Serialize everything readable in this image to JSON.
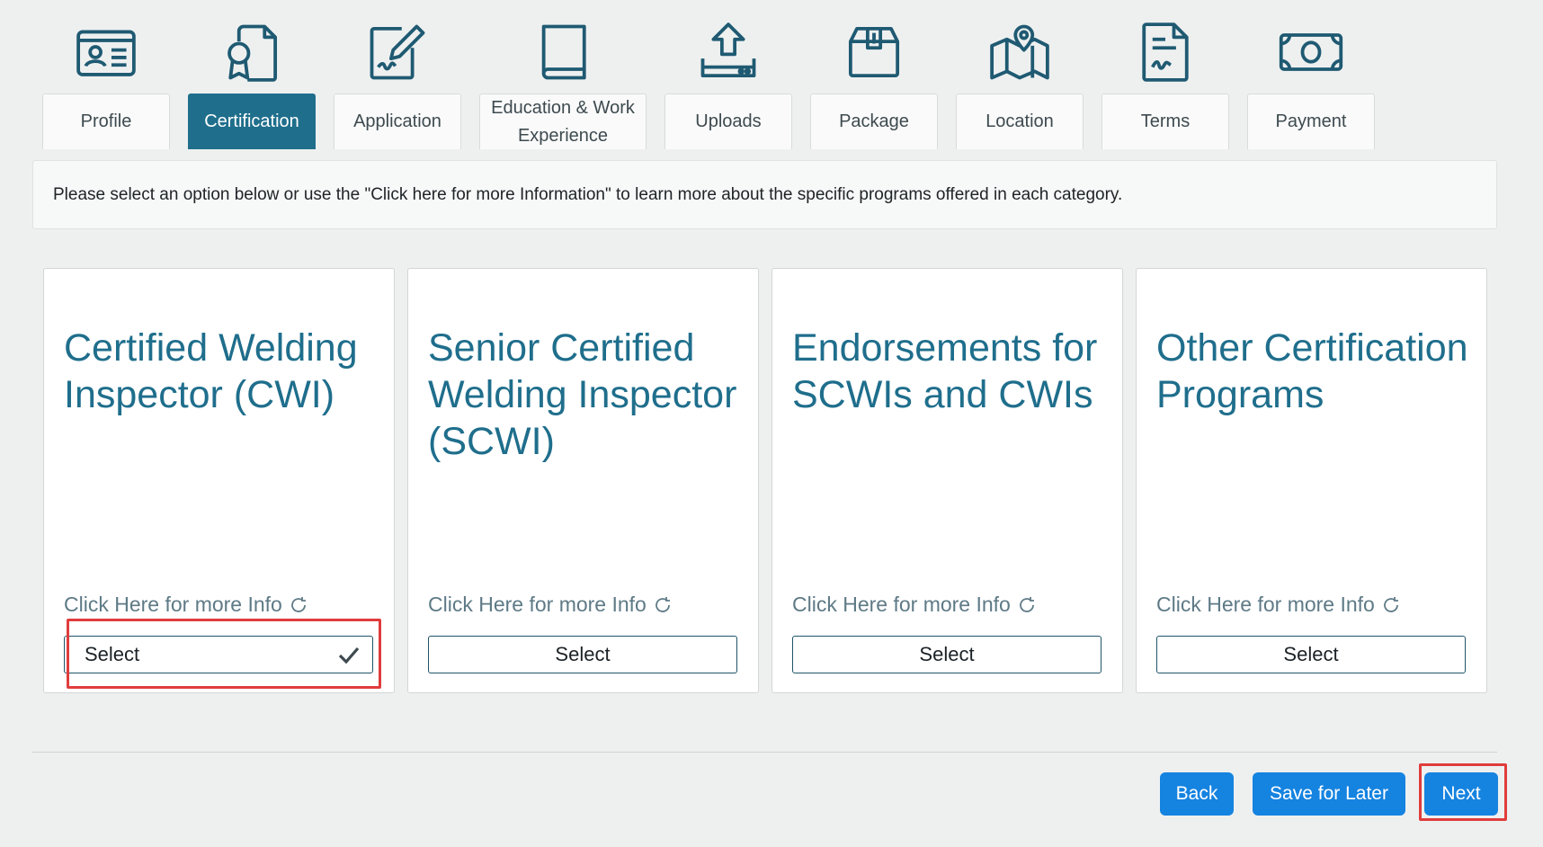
{
  "colors": {
    "accent": "#1f6e8c",
    "primary_button": "#1583e0",
    "highlight": "#e03c3c",
    "page_bg": "#eef0f0"
  },
  "steps": [
    {
      "label": "Profile",
      "icon": "id-card-icon",
      "active": false
    },
    {
      "label": "Certification",
      "icon": "certificate-icon",
      "active": true
    },
    {
      "label": "Application",
      "icon": "signature-pen-icon",
      "active": false
    },
    {
      "label": "Education & Work Experience",
      "icon": "book-icon",
      "active": false
    },
    {
      "label": "Uploads",
      "icon": "upload-icon",
      "active": false
    },
    {
      "label": "Package",
      "icon": "package-icon",
      "active": false
    },
    {
      "label": "Location",
      "icon": "map-pin-icon",
      "active": false
    },
    {
      "label": "Terms",
      "icon": "document-signature-icon",
      "active": false
    },
    {
      "label": "Payment",
      "icon": "money-icon",
      "active": false
    }
  ],
  "info_text": "Please select an option below or use the \"Click here for more Information\" to learn more about the specific programs offered in each category.",
  "cards": [
    {
      "title": "Certified Welding Inspector (CWI)",
      "info_link": "Click Here for more Info",
      "select_label": "Select",
      "selected": true
    },
    {
      "title": "Senior Certified Welding Inspector (SCWI)",
      "info_link": "Click Here for more Info",
      "select_label": "Select",
      "selected": false
    },
    {
      "title": "Endorsements for SCWIs and CWIs",
      "info_link": "Click Here for more Info",
      "select_label": "Select",
      "selected": false
    },
    {
      "title": "Other Certification Programs",
      "info_link": "Click Here for more Info",
      "select_label": "Select",
      "selected": false
    }
  ],
  "footer": {
    "back_label": "Back",
    "save_label": "Save for Later",
    "next_label": "Next"
  }
}
